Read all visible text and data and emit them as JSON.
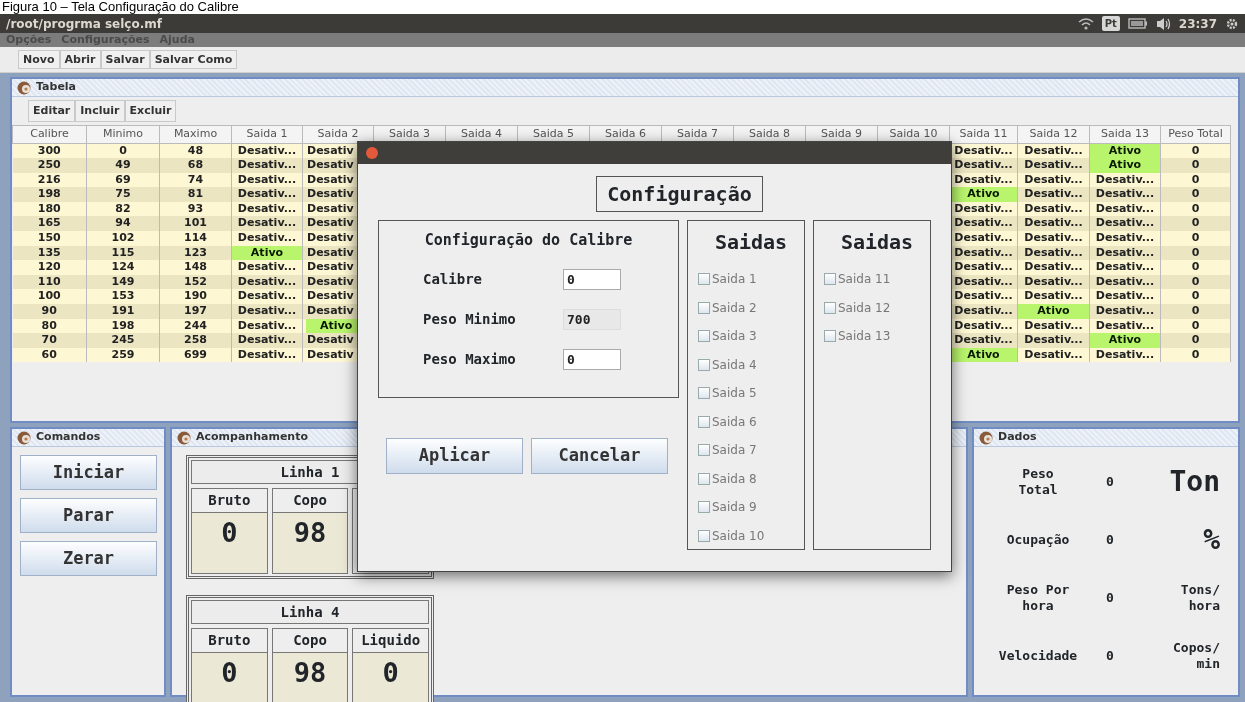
{
  "caption": "Figura 10 – Tela Configuração do Calibre",
  "window": {
    "title": "/root/progrma selço.mf",
    "keyboard_layout": "Pt",
    "clock": "23:37"
  },
  "menu": [
    "Opções",
    "Configurações",
    "Ajuda"
  ],
  "toolbar": [
    "Novo",
    "Abrir",
    "Salvar",
    "Salvar Como"
  ],
  "table_panel": {
    "title": "Tabela",
    "actions": [
      "Editar",
      "Incluir",
      "Excluir"
    ],
    "columns": [
      "Calibre",
      "Minimo",
      "Maximo",
      "Saida 1",
      "Saida 2",
      "Saida 3",
      "Saida 4",
      "Saida 5",
      "Saida 6",
      "Saida 7",
      "Saida 8",
      "Saida 9",
      "Saida 10",
      "Saida 11",
      "Saida 12",
      "Saida 13",
      "Peso Total"
    ],
    "rows": [
      {
        "values": [
          "300",
          "0",
          "48"
        ],
        "saidas": [
          {
            "text": "Desativ...",
            "active": false
          },
          {
            "text": "Desativ",
            "active": false
          },
          {
            "text": "Desativ...",
            "active": false
          },
          {
            "text": "Desativ...",
            "active": false
          },
          {
            "text": "Ativo",
            "active": true
          }
        ],
        "peso_total": "0"
      },
      {
        "values": [
          "250",
          "49",
          "68"
        ],
        "saidas": [
          {
            "text": "Desativ...",
            "active": false
          },
          {
            "text": "Desativ",
            "active": false
          },
          {
            "text": "Desativ...",
            "active": false
          },
          {
            "text": "Desativ...",
            "active": false
          },
          {
            "text": "Ativo",
            "active": true
          }
        ],
        "peso_total": "0"
      },
      {
        "values": [
          "216",
          "69",
          "74"
        ],
        "saidas": [
          {
            "text": "Desativ...",
            "active": false
          },
          {
            "text": "Desativ",
            "active": false
          },
          {
            "text": "Desativ...",
            "active": false
          },
          {
            "text": "Desativ...",
            "active": false
          },
          {
            "text": "Desativ...",
            "active": false
          }
        ],
        "peso_total": "0"
      },
      {
        "values": [
          "198",
          "75",
          "81"
        ],
        "saidas": [
          {
            "text": "Desativ...",
            "active": false
          },
          {
            "text": "Desativ",
            "active": false
          },
          {
            "text": "Ativo",
            "active": true
          },
          {
            "text": "Desativ...",
            "active": false
          },
          {
            "text": "Desativ...",
            "active": false
          }
        ],
        "peso_total": "0"
      },
      {
        "values": [
          "180",
          "82",
          "93"
        ],
        "saidas": [
          {
            "text": "Desativ...",
            "active": false
          },
          {
            "text": "Desativ",
            "active": false
          },
          {
            "text": "Desativ...",
            "active": false
          },
          {
            "text": "Desativ...",
            "active": false
          },
          {
            "text": "Desativ...",
            "active": false
          }
        ],
        "peso_total": "0"
      },
      {
        "values": [
          "165",
          "94",
          "101"
        ],
        "saidas": [
          {
            "text": "Desativ...",
            "active": false
          },
          {
            "text": "Desativ",
            "active": false
          },
          {
            "text": "Desativ...",
            "active": false
          },
          {
            "text": "Desativ...",
            "active": false
          },
          {
            "text": "Desativ...",
            "active": false
          }
        ],
        "peso_total": "0"
      },
      {
        "values": [
          "150",
          "102",
          "114"
        ],
        "saidas": [
          {
            "text": "Desativ...",
            "active": false
          },
          {
            "text": "Desativ",
            "active": false
          },
          {
            "text": "Desativ...",
            "active": false
          },
          {
            "text": "Desativ...",
            "active": false
          },
          {
            "text": "Desativ...",
            "active": false
          }
        ],
        "peso_total": "0"
      },
      {
        "values": [
          "135",
          "115",
          "123"
        ],
        "saidas": [
          {
            "text": "Ativo",
            "active": true
          },
          {
            "text": "Desativ",
            "active": false
          },
          {
            "text": "Desativ...",
            "active": false
          },
          {
            "text": "Desativ...",
            "active": false
          },
          {
            "text": "Desativ...",
            "active": false
          }
        ],
        "peso_total": "0"
      },
      {
        "values": [
          "120",
          "124",
          "148"
        ],
        "saidas": [
          {
            "text": "Desativ...",
            "active": false
          },
          {
            "text": "Desativ",
            "active": false
          },
          {
            "text": "Desativ...",
            "active": false
          },
          {
            "text": "Desativ...",
            "active": false
          },
          {
            "text": "Desativ...",
            "active": false
          }
        ],
        "peso_total": "0"
      },
      {
        "values": [
          "110",
          "149",
          "152"
        ],
        "saidas": [
          {
            "text": "Desativ...",
            "active": false
          },
          {
            "text": "Desativ",
            "active": false
          },
          {
            "text": "Desativ...",
            "active": false
          },
          {
            "text": "Desativ...",
            "active": false
          },
          {
            "text": "Desativ...",
            "active": false
          }
        ],
        "peso_total": "0"
      },
      {
        "values": [
          "100",
          "153",
          "190"
        ],
        "saidas": [
          {
            "text": "Desativ...",
            "active": false
          },
          {
            "text": "Desativ",
            "active": false
          },
          {
            "text": "Desativ...",
            "active": false
          },
          {
            "text": "Desativ...",
            "active": false
          },
          {
            "text": "Desativ...",
            "active": false
          }
        ],
        "peso_total": "0"
      },
      {
        "values": [
          "90",
          "191",
          "197"
        ],
        "saidas": [
          {
            "text": "Desativ...",
            "active": false
          },
          {
            "text": "Desativ",
            "active": false
          },
          {
            "text": "Desativ...",
            "active": false
          },
          {
            "text": "Ativo",
            "active": true
          },
          {
            "text": "Desativ...",
            "active": false
          }
        ],
        "peso_total": "0"
      },
      {
        "values": [
          "80",
          "198",
          "244"
        ],
        "saidas": [
          {
            "text": "Desativ...",
            "active": false
          },
          {
            "text": "Ativo",
            "active": true
          },
          {
            "text": "Desativ...",
            "active": false
          },
          {
            "text": "Desativ...",
            "active": false
          },
          {
            "text": "Desativ...",
            "active": false
          }
        ],
        "peso_total": "0"
      },
      {
        "values": [
          "70",
          "245",
          "258"
        ],
        "saidas": [
          {
            "text": "Desativ...",
            "active": false
          },
          {
            "text": "Desativ",
            "active": false
          },
          {
            "text": "Desativ...",
            "active": false
          },
          {
            "text": "Desativ...",
            "active": false
          },
          {
            "text": "Ativo",
            "active": true
          }
        ],
        "peso_total": "0"
      },
      {
        "values": [
          "60",
          "259",
          "699"
        ],
        "saidas": [
          {
            "text": "Desativ...",
            "active": false
          },
          {
            "text": "Desativ",
            "active": false
          },
          {
            "text": "Ativo",
            "active": true
          },
          {
            "text": "Desativ...",
            "active": false
          },
          {
            "text": "Desativ...",
            "active": false
          }
        ],
        "peso_total": "0"
      }
    ]
  },
  "commands": {
    "title": "Comandos",
    "buttons": [
      "Iniciar",
      "Parar",
      "Zerar"
    ]
  },
  "monitor": {
    "title": "Acompanhamento",
    "lines": [
      {
        "title": "Linha 1",
        "cells": [
          {
            "label": "Bruto",
            "value": "0"
          },
          {
            "label": "Copo",
            "value": "98"
          }
        ]
      },
      {
        "title": "Linha 4",
        "cells": [
          {
            "label": "Bruto",
            "value": "0"
          },
          {
            "label": "Copo",
            "value": "98"
          },
          {
            "label": "Liquido",
            "value": "0"
          }
        ]
      }
    ]
  },
  "data_panel": {
    "title": "Dados",
    "rows": [
      {
        "label": "Peso\nTotal",
        "value": "0",
        "unit": "Ton",
        "kind": "large"
      },
      {
        "label": "Ocupação",
        "value": "0",
        "unit": "%",
        "kind": "large"
      },
      {
        "label": "Peso Por\nhora",
        "value": "0",
        "unit": "Tons/\nhora",
        "kind": "small"
      },
      {
        "label": "Velocidade",
        "value": "0",
        "unit": "Copos/\nmin",
        "kind": "small"
      }
    ]
  },
  "dialog": {
    "heading": "Configuração",
    "group_title": "Configuração do Calibre",
    "fields": [
      {
        "label": "Calibre",
        "value": "0",
        "disabled": false
      },
      {
        "label": "Peso Minimo",
        "value": "700",
        "disabled": true
      },
      {
        "label": "Peso Maximo",
        "value": "0",
        "disabled": false
      }
    ],
    "buttons": [
      "Aplicar",
      "Cancelar"
    ],
    "output_groups": [
      {
        "title": "Saidas",
        "items": [
          {
            "label": "Saida 1",
            "checked": false
          },
          {
            "label": "Saida 2",
            "checked": false
          },
          {
            "label": "Saida 3",
            "checked": false
          },
          {
            "label": "Saida 4",
            "checked": false
          },
          {
            "label": "Saida 5",
            "checked": false
          },
          {
            "label": "Saida 6",
            "checked": false
          },
          {
            "label": "Saida 7",
            "checked": false
          },
          {
            "label": "Saida 8",
            "checked": false
          },
          {
            "label": "Saida 9",
            "checked": false
          },
          {
            "label": "Saida 10",
            "checked": false
          }
        ]
      },
      {
        "title": "Saidas",
        "items": [
          {
            "label": "Saida 11",
            "checked": false
          },
          {
            "label": "Saida 12",
            "checked": false
          },
          {
            "label": "Saida 13",
            "checked": false
          }
        ]
      }
    ]
  }
}
